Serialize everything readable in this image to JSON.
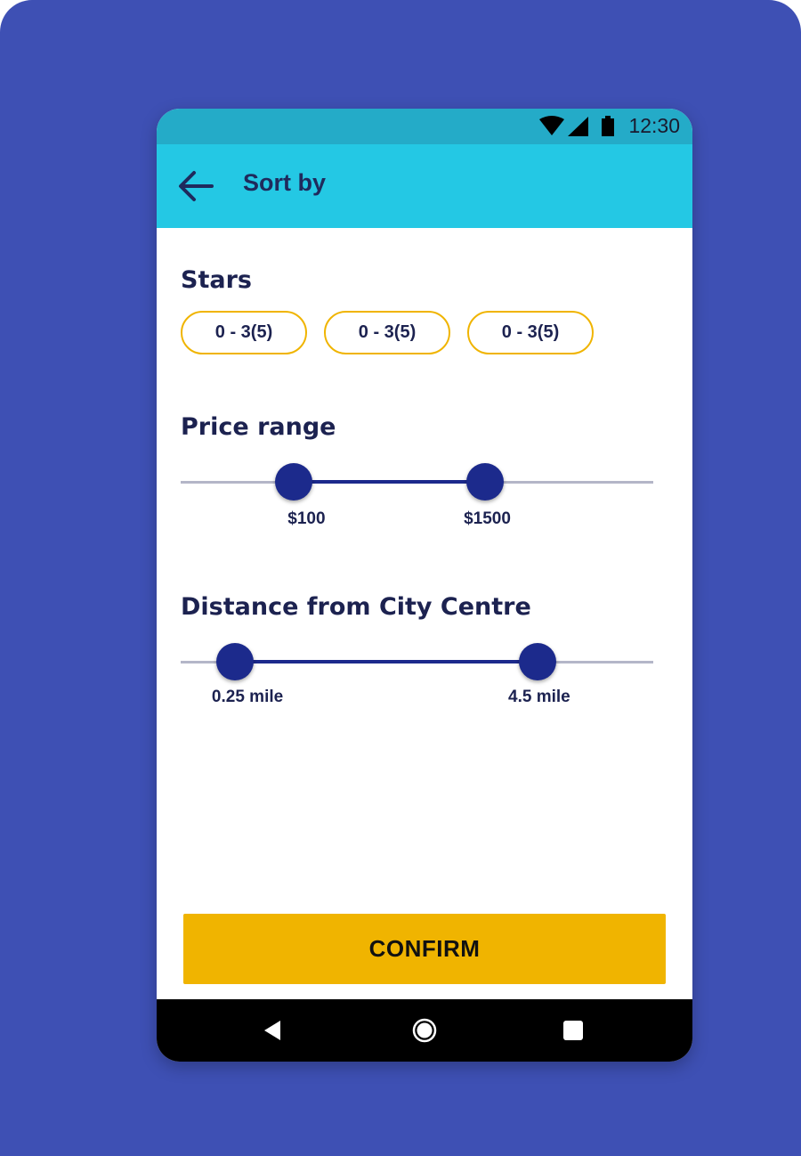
{
  "status_bar": {
    "time": "12:30",
    "icons": [
      "wifi-icon",
      "signal-icon",
      "battery-icon"
    ]
  },
  "app_bar": {
    "title": "Sort by",
    "back_icon": "arrow-left-icon"
  },
  "stars": {
    "title": "Stars",
    "chips": [
      {
        "label": "0 - 3(5)"
      },
      {
        "label": "0 - 3(5)"
      },
      {
        "label": "0 - 3(5)"
      }
    ]
  },
  "price_range": {
    "title": "Price range",
    "min_label": "$100",
    "max_label": "$1500",
    "min_fraction": 0.24,
    "max_fraction": 0.645
  },
  "distance": {
    "title": "Distance from City Centre",
    "min_label": "0.25 mile",
    "max_label": "4.5 mile",
    "min_fraction": 0.115,
    "max_fraction": 0.755
  },
  "confirm_button": {
    "label": "CONFIRM"
  },
  "nav_bar": {
    "icons": [
      "back-triangle-icon",
      "home-circle-icon",
      "recents-square-icon"
    ]
  },
  "colors": {
    "background": "#3e50b4",
    "status_bar": "#24abc8",
    "app_bar": "#24c8e4",
    "accent": "#f0b400",
    "slider": "#1c2a8c",
    "text_dark": "#1c2250"
  }
}
